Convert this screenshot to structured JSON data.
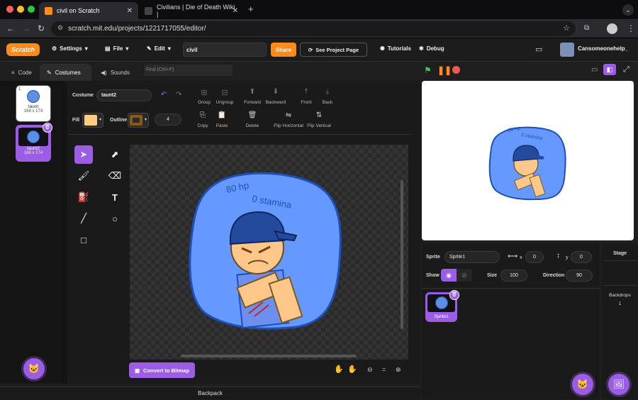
{
  "browser": {
    "tabs": [
      {
        "title": "civil on Scratch",
        "active": true
      },
      {
        "title": "Civilians | Die of Death Wiki |",
        "active": false
      }
    ],
    "url": "scratch.mit.edu/projects/1221717055/editor/"
  },
  "menu": {
    "logo": "Scratch",
    "settings": "Settings",
    "file": "File",
    "edit": "Edit",
    "project_title": "civil",
    "share": "Share",
    "see_project_page": "See Project Page",
    "tutorials": "Tutorials",
    "debug": "Debug",
    "username": "Cansomeonehelp_"
  },
  "editor_tabs": {
    "code": "Code",
    "costumes": "Costumes",
    "sounds": "Sounds"
  },
  "find_placeholder": "Find (Ctrl+F)",
  "costumes": [
    {
      "index": "1",
      "name": "taunt",
      "size": "168 x 174"
    },
    {
      "index": "2",
      "name": "taunt2",
      "size": "168 x 174",
      "selected": true
    }
  ],
  "paint": {
    "costume_label": "Costume",
    "costume_name": "taunt2",
    "group": "Group",
    "ungroup": "Ungroup",
    "forward": "Forward",
    "backward": "Backward",
    "front": "Front",
    "back": "Back",
    "fill_label": "Fill",
    "outline_label": "Outline",
    "outline_width": "4",
    "copy": "Copy",
    "paste": "Paste",
    "delete": "Delete",
    "flip_horizontal": "Flip Horizontal",
    "flip_vertical": "Flip Vertical",
    "convert_bitmap": "Convert to Bitmap",
    "fill_color": "#ffcc88",
    "outline_color": "#8a5a1a"
  },
  "artwork": {
    "hp_text": "80 hp",
    "stamina_text": "0 stamina"
  },
  "backpack": "Backpack",
  "sprite_info": {
    "sprite_label": "Sprite",
    "sprite_name": "Sprite1",
    "x_label": "x",
    "x": "0",
    "y_label": "y",
    "y": "0",
    "show_label": "Show",
    "size_label": "Size",
    "size": "100",
    "direction_label": "Direction",
    "direction": "90"
  },
  "sprites": [
    {
      "name": "Sprite1"
    }
  ],
  "stage_panel": {
    "title": "Stage",
    "backdrops_label": "Backdrops",
    "backdrops_count": "1"
  },
  "colors": {
    "accent": "#9b5de5",
    "share": "#ff8c1a",
    "go": "#4cbf56",
    "stop": "#ec5959"
  }
}
